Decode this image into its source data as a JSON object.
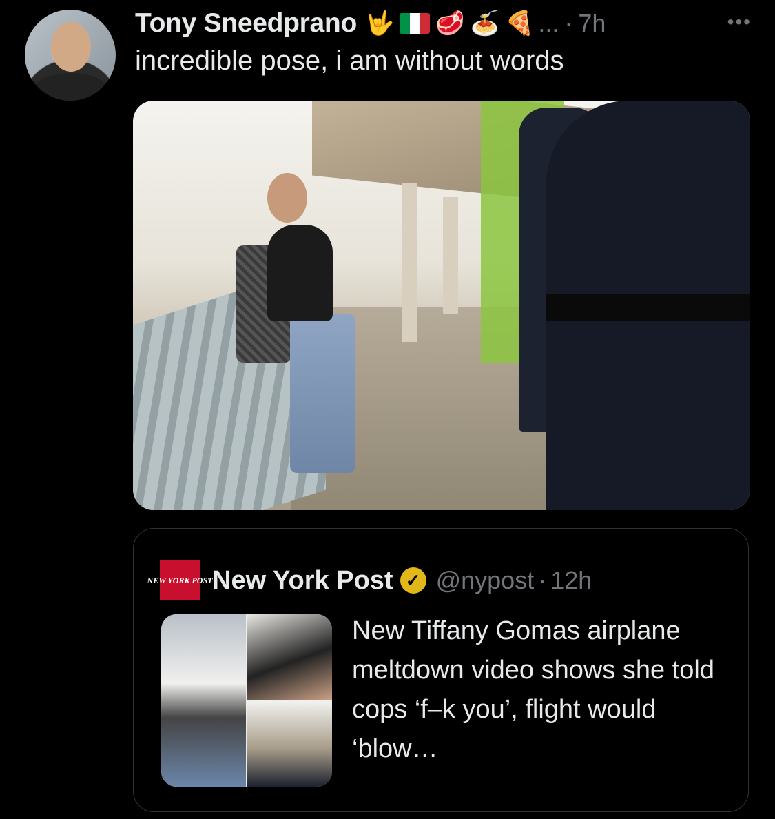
{
  "tweet": {
    "author_name": "Tony Sneedprano",
    "emojis": [
      "🤟",
      "flag",
      "🥩",
      "🍝",
      "🍕"
    ],
    "ellipsis": "...",
    "separator": "·",
    "time": "7h",
    "more": "•••",
    "text": "incredible pose, i am without words",
    "flag_colors": [
      "#009246",
      "#ffffff",
      "#ce2b37"
    ]
  },
  "quoted": {
    "logo_text": "NEW YORK POST",
    "name": "New York Post",
    "verified_icon": "✓",
    "handle": "@nypost",
    "separator": "·",
    "time": "12h",
    "headline": "New Tiffany Gomas airplane meltdown video shows she told cops ‘f–k you’, flight would ‘blow…",
    "logo_color": "#c8102e",
    "verified_color": "#e2b719"
  }
}
